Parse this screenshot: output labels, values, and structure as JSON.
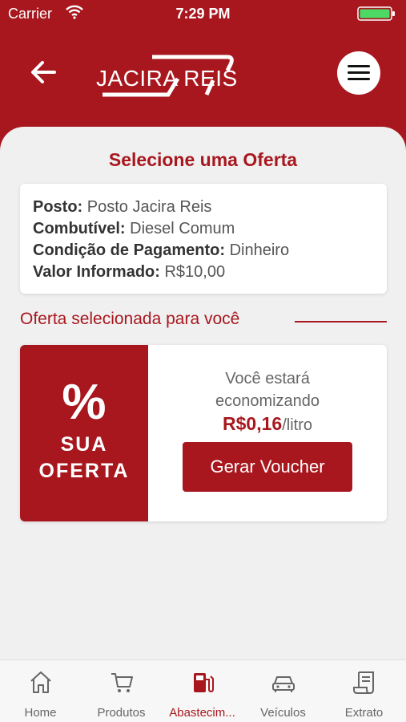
{
  "status_bar": {
    "carrier": "Carrier",
    "time": "7:29 PM"
  },
  "header": {
    "logo_text": "JACIRA REIS"
  },
  "page": {
    "title": "Selecione uma Oferta"
  },
  "info": {
    "posto_label": "Posto:",
    "posto_value": "Posto Jacira Reis",
    "combustivel_label": "Combutível:",
    "combustivel_value": "Diesel Comum",
    "pagamento_label": "Condição de Pagamento:",
    "pagamento_value": "Dinheiro",
    "valor_label": "Valor Informado:",
    "valor_value": "R$10,00"
  },
  "offer": {
    "section_title": "Oferta selecionada para você",
    "badge_symbol": "%",
    "badge_line1": "SUA",
    "badge_line2": "OFERTA",
    "text_line1": "Você estará",
    "text_line2": "economizando",
    "amount": "R$0,16",
    "unit": "/litro",
    "button_label": "Gerar Voucher"
  },
  "tabs": [
    {
      "label": "Home",
      "icon": "home-icon"
    },
    {
      "label": "Produtos",
      "icon": "cart-icon"
    },
    {
      "label": "Abastecim...",
      "icon": "fuel-pump-icon",
      "active": true
    },
    {
      "label": "Veículos",
      "icon": "car-icon"
    },
    {
      "label": "Extrato",
      "icon": "receipt-icon"
    }
  ],
  "colors": {
    "brand": "#a8171e",
    "background": "#f0f0f0"
  }
}
